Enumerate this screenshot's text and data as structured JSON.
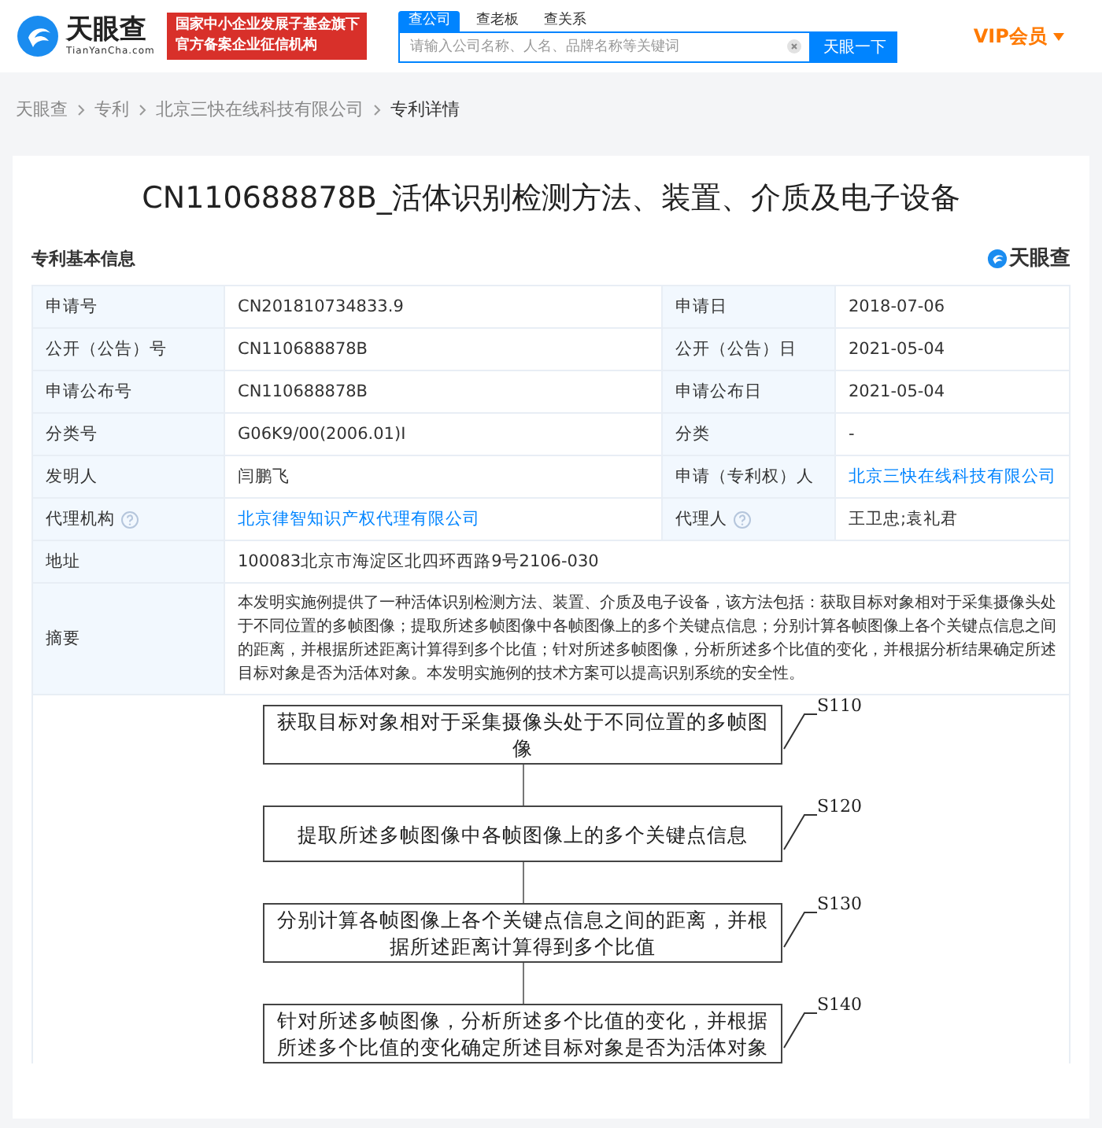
{
  "header": {
    "logo": {
      "name": "天眼查",
      "domain": "TianYanCha.com"
    },
    "slogan": [
      "国家中小企业发展子基金旗下",
      "官方备案企业征信机构"
    ],
    "search": {
      "tabs": [
        {
          "label": "查公司",
          "selected": true
        },
        {
          "label": "查老板",
          "selected": false
        },
        {
          "label": "查关系",
          "selected": false
        }
      ],
      "placeholder": "请输入公司名称、人名、品牌名称等关键词",
      "button": "天眼一下"
    },
    "vip": "VIP会员"
  },
  "breadcrumb": [
    "天眼查",
    "专利",
    "北京三快在线科技有限公司",
    "专利详情"
  ],
  "patent": {
    "title": "CN110688878B_活体识别检测方法、装置、介质及电子设备",
    "section_title": "专利基本信息",
    "brand": "天眼查",
    "rows": [
      {
        "kind": "pair",
        "cells": [
          {
            "label": "申请号",
            "value": "CN201810734833.9",
            "help": false,
            "link": false
          },
          {
            "label": "申请日",
            "value": "2018-07-06",
            "help": false,
            "link": false
          }
        ]
      },
      {
        "kind": "pair",
        "cells": [
          {
            "label": "公开（公告）号",
            "value": "CN110688878B",
            "help": false,
            "link": false
          },
          {
            "label": "公开（公告）日",
            "value": "2021-05-04",
            "help": false,
            "link": false
          }
        ]
      },
      {
        "kind": "pair",
        "cells": [
          {
            "label": "申请公布号",
            "value": "CN110688878B",
            "help": false,
            "link": false
          },
          {
            "label": "申请公布日",
            "value": "2021-05-04",
            "help": false,
            "link": false
          }
        ]
      },
      {
        "kind": "pair",
        "cells": [
          {
            "label": "分类号",
            "value": "G06K9/00(2006.01)I",
            "help": false,
            "link": false
          },
          {
            "label": "分类",
            "value": "-",
            "help": false,
            "link": false
          }
        ]
      },
      {
        "kind": "pair",
        "cells": [
          {
            "label": "发明人",
            "value": "闫鹏飞",
            "help": false,
            "link": false
          },
          {
            "label": "申请（专利权）人",
            "value": "北京三快在线科技有限公司",
            "help": false,
            "link": true
          }
        ]
      },
      {
        "kind": "pair",
        "cells": [
          {
            "label": "代理机构",
            "value": "北京律智知识产权代理有限公司",
            "help": true,
            "link": true
          },
          {
            "label": "代理人",
            "value": "王卫忠;袁礼君",
            "help": true,
            "link": false
          }
        ]
      },
      {
        "kind": "wide",
        "cells": [
          {
            "label": "地址",
            "value": "100083北京市海淀区北四环西路9号2106-030",
            "help": false,
            "link": false
          }
        ]
      },
      {
        "kind": "text",
        "cells": [
          {
            "label": "摘要",
            "value": "本发明实施例提供了一种活体识别检测方法、装置、介质及电子设备，该方法包括：获取目标对象相对于采集摄像头处于不同位置的多帧图像；提取所述多帧图像中各帧图像上的多个关键点信息；分别计算各帧图像上各个关键点信息之间的距离，并根据所述距离计算得到多个比值；针对所述多帧图像，分析所述多个比值的变化，并根据分析结果确定所述目标对象是否为活体对象。本发明实施例的技术方案可以提高识别系统的安全性。",
            "help": false,
            "link": false
          }
        ]
      }
    ],
    "figure": {
      "steps": [
        {
          "text": "获取目标对象相对于采集摄像头处于不同位置的多帧图像",
          "code": "S110"
        },
        {
          "text": "提取所述多帧图像中各帧图像上的多个关键点信息",
          "code": "S120"
        },
        {
          "text": "分别计算各帧图像上各个关键点信息之间的距离，并根据所述距离计算得到多个比值",
          "code": "S130"
        },
        {
          "text": "针对所述多帧图像，分析所述多个比值的变化，并根据所述多个比值的变化确定所述目标对象是否为活体对象",
          "code": "S140"
        }
      ]
    }
  }
}
